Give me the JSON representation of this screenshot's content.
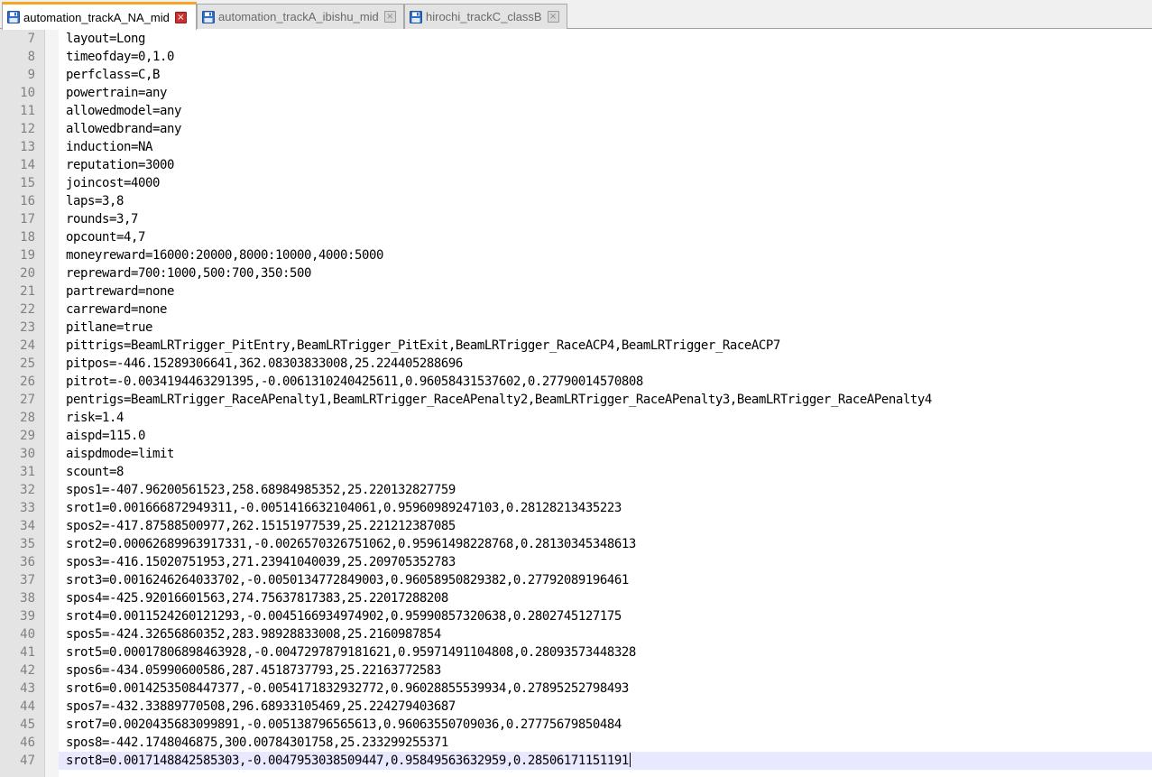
{
  "tabs": [
    {
      "label": "automation_trackA_NA_mid",
      "active": true,
      "icon": "floppy-disk-icon"
    },
    {
      "label": "automation_trackA_ibishu_mid",
      "active": false,
      "icon": "floppy-disk-icon"
    },
    {
      "label": "hirochi_trackC_classB",
      "active": false,
      "icon": "floppy-disk-icon"
    }
  ],
  "tab_close_glyph": "×",
  "colors": {
    "active_tab_accent": "#f5a623",
    "close_button_active": "#c8322e",
    "file_icon": "#2f6fc7",
    "current_line_highlight": "#e8e8ff",
    "gutter_background": "#e4e4e4"
  },
  "editor": {
    "current_line": 47,
    "lines": [
      {
        "number": "7",
        "text": "layout=Long"
      },
      {
        "number": "8",
        "text": "timeofday=0,1.0"
      },
      {
        "number": "9",
        "text": "perfclass=C,B"
      },
      {
        "number": "10",
        "text": "powertrain=any"
      },
      {
        "number": "11",
        "text": "allowedmodel=any"
      },
      {
        "number": "12",
        "text": "allowedbrand=any"
      },
      {
        "number": "13",
        "text": "induction=NA"
      },
      {
        "number": "14",
        "text": "reputation=3000"
      },
      {
        "number": "15",
        "text": "joincost=4000"
      },
      {
        "number": "16",
        "text": "laps=3,8"
      },
      {
        "number": "17",
        "text": "rounds=3,7"
      },
      {
        "number": "18",
        "text": "opcount=4,7"
      },
      {
        "number": "19",
        "text": "moneyreward=16000:20000,8000:10000,4000:5000"
      },
      {
        "number": "20",
        "text": "repreward=700:1000,500:700,350:500"
      },
      {
        "number": "21",
        "text": "partreward=none"
      },
      {
        "number": "22",
        "text": "carreward=none"
      },
      {
        "number": "23",
        "text": "pitlane=true"
      },
      {
        "number": "24",
        "text": "pittrigs=BeamLRTrigger_PitEntry,BeamLRTrigger_PitExit,BeamLRTrigger_RaceACP4,BeamLRTrigger_RaceACP7"
      },
      {
        "number": "25",
        "text": "pitpos=-446.15289306641,362.08303833008,25.224405288696"
      },
      {
        "number": "26",
        "text": "pitrot=-0.003419446329139­5,-0.0061310240425611,0.96058431537602,0.27790014570808"
      },
      {
        "number": "27",
        "text": "pentrigs=BeamLRTrigger_RaceAPenalty1,BeamLRTrigger_RaceAPenalty2,BeamLRTrigger_RaceAPenalty3,BeamLRTrigger_RaceAPenalty4"
      },
      {
        "number": "28",
        "text": "risk=1.4"
      },
      {
        "number": "29",
        "text": "aispd=115.0"
      },
      {
        "number": "30",
        "text": "aispdmode=limit"
      },
      {
        "number": "31",
        "text": "scount=8"
      },
      {
        "number": "32",
        "text": "spos1=-407.96200561523,258.68984985352,25.220132827759"
      },
      {
        "number": "33",
        "text": "srot1=0.001666872949311,-0.0051416632104061,0.95960989247103,0.28128213435223"
      },
      {
        "number": "34",
        "text": "spos2=-417.87588500977,262.15151977539,25.221212387085"
      },
      {
        "number": "35",
        "text": "srot2=0.00062689963917331,-0.0026570326751062,0.95961498228768,0.28130345348613"
      },
      {
        "number": "36",
        "text": "spos3=-416.15020751953,271.23941040039,25.209705352783"
      },
      {
        "number": "37",
        "text": "srot3=0.0016246264033702,-0.0050134772849003,0.96058950829382,0.27792089196461"
      },
      {
        "number": "38",
        "text": "spos4=-425.92016601563,274.75637817383,25.22017288208"
      },
      {
        "number": "39",
        "text": "srot4=0.0011524260121293,-0.0045166934974902,0.95990857320638,0.2802745127175"
      },
      {
        "number": "40",
        "text": "spos5=-424.32656860352,283.98928833008,25.2160987854"
      },
      {
        "number": "41",
        "text": "srot5=0.00017806898463928,-0.0047297879181621,0.95971491104808,0.28093573448328"
      },
      {
        "number": "42",
        "text": "spos6=-434.05990600586,287.4518737793,25.22163772583"
      },
      {
        "number": "43",
        "text": "srot6=0.0014253508447377,-0.0054171832932772,0.96028855539934,0.27895252798493"
      },
      {
        "number": "44",
        "text": "spos7=-432.33889770508,296.68933105469,25.224279403687"
      },
      {
        "number": "45",
        "text": "srot7=0.0020435683099891,-0.005138796565613,0.96063550709036,0.27775679850484"
      },
      {
        "number": "46",
        "text": "spos8=-442.1748046875,300.00784301758,25.233299255371"
      },
      {
        "number": "47",
        "text": "srot8=0.0017148842585303,-0.0047953038509447,0.95849563632959,0.28506171151191"
      }
    ]
  }
}
